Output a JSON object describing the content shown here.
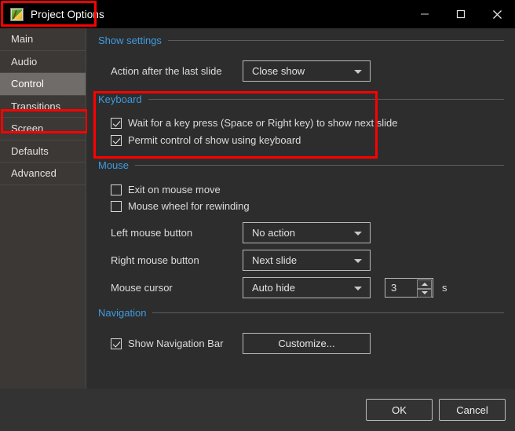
{
  "window": {
    "title": "Project Options",
    "app_icon": "project-image-icon",
    "controls": {
      "minimize": "minimize-icon",
      "maximize": "maximize-icon",
      "close": "close-icon"
    },
    "highlight_color": "#ff0000"
  },
  "sidebar": {
    "items": [
      {
        "label": "Main",
        "selected": false
      },
      {
        "label": "Audio",
        "selected": false
      },
      {
        "label": "Control",
        "selected": true
      },
      {
        "label": "Transitions",
        "selected": false
      },
      {
        "label": "Screen",
        "selected": false
      },
      {
        "label": "Defaults",
        "selected": false
      },
      {
        "label": "Advanced",
        "selected": false
      }
    ]
  },
  "groups": {
    "show_settings": {
      "title": "Show settings",
      "action_after_last_slide": {
        "label": "Action after the last slide",
        "value": "Close show"
      }
    },
    "keyboard": {
      "title": "Keyboard",
      "wait_key_press": {
        "label": "Wait for a key press (Space or Right key) to show next slide",
        "checked": true
      },
      "permit_control": {
        "label": "Permit control of show using keyboard",
        "checked": true
      }
    },
    "mouse": {
      "title": "Mouse",
      "exit_on_mouse_move": {
        "label": "Exit on mouse move",
        "checked": false
      },
      "mouse_wheel_rewind": {
        "label": "Mouse wheel for rewinding",
        "checked": false
      },
      "left_button": {
        "label": "Left mouse button",
        "value": "No action"
      },
      "right_button": {
        "label": "Right mouse button",
        "value": "Next slide"
      },
      "cursor": {
        "label": "Mouse cursor",
        "value": "Auto hide",
        "seconds": "3",
        "unit": "s"
      }
    },
    "navigation": {
      "title": "Navigation",
      "show_nav_bar": {
        "label": "Show Navigation Bar",
        "checked": true
      },
      "customize_button": "Customize..."
    }
  },
  "footer": {
    "ok": "OK",
    "cancel": "Cancel"
  },
  "colors": {
    "group_title": "#3f9be0",
    "highlight": "#ff0000",
    "selected_item_bg": "#6f6c69"
  }
}
